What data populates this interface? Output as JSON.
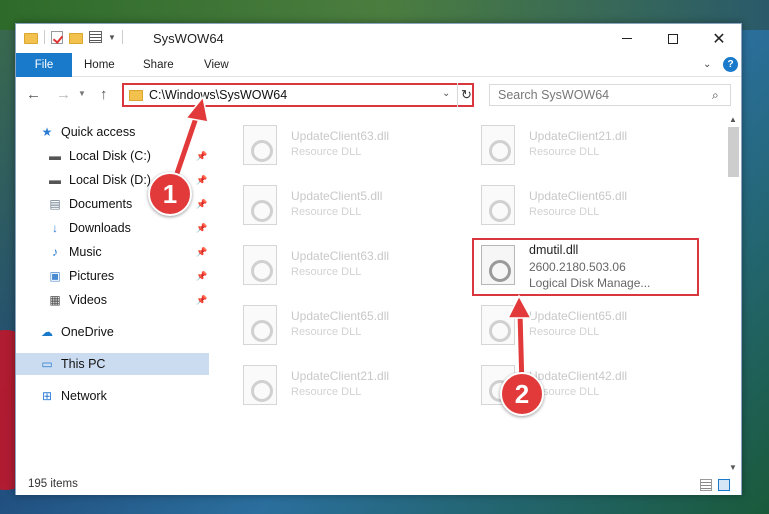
{
  "window": {
    "title": "SysWOW64"
  },
  "ribbon": {
    "tabs": [
      {
        "label": "File"
      },
      {
        "label": "Home"
      },
      {
        "label": "Share"
      },
      {
        "label": "View"
      }
    ]
  },
  "address": {
    "path": "C:\\Windows\\SysWOW64",
    "search_placeholder": "Search SysWOW64"
  },
  "sidebar": {
    "items": [
      {
        "label": "Quick access",
        "icon": "star-icon",
        "pinned": false
      },
      {
        "label": "Local Disk (C:)",
        "icon": "drive-icon",
        "pinned": true
      },
      {
        "label": "Local Disk (D:)",
        "icon": "drive-icon",
        "pinned": true
      },
      {
        "label": "Documents",
        "icon": "document-icon",
        "pinned": true
      },
      {
        "label": "Downloads",
        "icon": "download-icon",
        "pinned": true
      },
      {
        "label": "Music",
        "icon": "music-icon",
        "pinned": true
      },
      {
        "label": "Pictures",
        "icon": "pictures-icon",
        "pinned": true
      },
      {
        "label": "Videos",
        "icon": "video-icon",
        "pinned": true
      },
      {
        "label": "OneDrive",
        "icon": "cloud-icon",
        "pinned": false
      },
      {
        "label": "This PC",
        "icon": "computer-icon",
        "pinned": false,
        "selected": true
      },
      {
        "label": "Network",
        "icon": "network-icon",
        "pinned": false
      }
    ]
  },
  "files": [
    {
      "name": "UpdateClient63.dll",
      "type": "Resource DLL"
    },
    {
      "name": "UpdateClient21.dll",
      "type": "Resource DLL"
    },
    {
      "name": "UpdateClient5.dll",
      "type": "Resource DLL"
    },
    {
      "name": "UpdateClient65.dll",
      "type": "Resource DLL"
    },
    {
      "name": "UpdateClient63.dll",
      "type": "Resource DLL"
    },
    {
      "name": "dmutil.dll",
      "version": "2600.2180.503.06",
      "description": "Logical Disk Manage...",
      "highlighted": true
    },
    {
      "name": "UpdateClient65.dll",
      "type": "Resource DLL"
    },
    {
      "name": "UpdateClient65.dll",
      "type": "Resource DLL"
    },
    {
      "name": "UpdateClient21.dll",
      "type": "Resource DLL"
    },
    {
      "name": "UpdateClient42.dll",
      "type": "Resource DLL"
    }
  ],
  "status": {
    "item_count": "195 items"
  },
  "annotations": {
    "step1": "1",
    "step2": "2"
  },
  "colors": {
    "accent": "#1979ca",
    "highlight_red": "#d9373d",
    "selection": "#ccdcf0"
  }
}
